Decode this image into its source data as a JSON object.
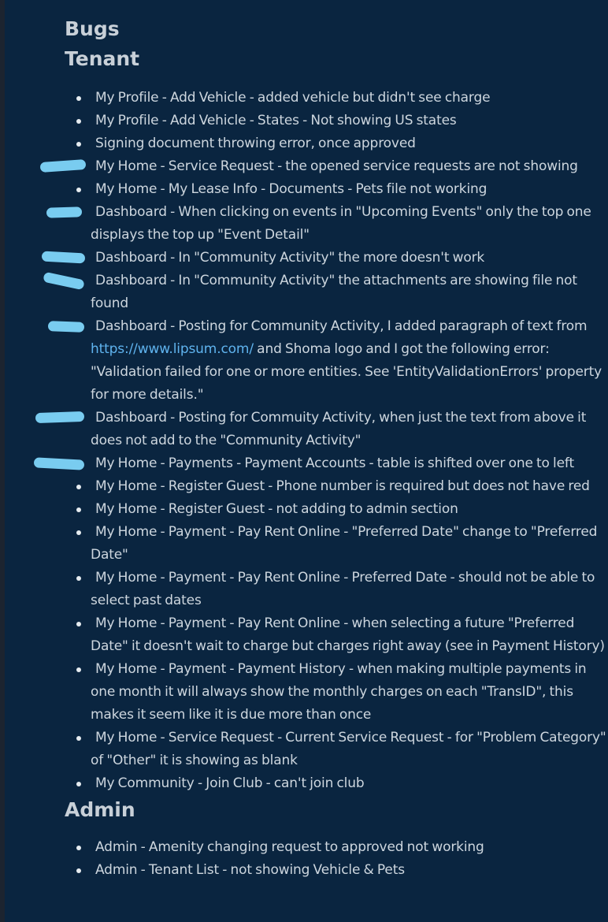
{
  "title": "Bugs",
  "tenant": {
    "heading": "Tenant",
    "items": [
      {
        "text": "My Profile - Add Vehicle - added vehicle but didn't see charge"
      },
      {
        "text": "My Profile - Add Vehicle - States - Not showing US states"
      },
      {
        "text": "Signing document throwing error, once approved"
      },
      {
        "text": "My Home - Service Request - the opened service requests are not showing"
      },
      {
        "text": "My Home - My Lease Info - Documents - Pets file not working"
      },
      {
        "text": "Dashboard - When clicking on events in \"Upcoming Events\" only the top one displays the top up \"Event Detail\""
      },
      {
        "text": "Dashboard - In \"Community Activity\" the more doesn't work"
      },
      {
        "text": "Dashboard - In \"Community Activity\" the attachments are showing file not found"
      },
      {
        "text_before": "Dashboard - Posting for Community Activity, I added paragraph of text from ",
        "link": "https://www.lipsum.com/",
        "text_after": " and Shoma logo and I got the following error: \"Validation failed for one or more entities. See 'EntityValidationErrors' property for more details.\""
      },
      {
        "text": "Dashboard - Posting for Commuity Activity, when just the text from above it does not add to the \"Community Activity\""
      },
      {
        "text": "My Home - Payments - Payment Accounts - table is shifted over one to left"
      },
      {
        "text": "My Home - Register Guest - Phone number is required but does not have red"
      },
      {
        "text": "My Home - Register Guest - not adding to admin section"
      },
      {
        "text": "My Home - Payment - Pay Rent Online - \"Preferred Date\" change to \"Preferred Date\""
      },
      {
        "text": "My Home - Payment - Pay Rent Online - Preferred Date - should not be able to select past dates"
      },
      {
        "text": "My Home - Payment - Pay Rent Online - when selecting a future \"Preferred Date\" it doesn't wait to charge but charges right away (see in Payment History)"
      },
      {
        "text": "My Home - Payment - Payment History - when making multiple payments in one month it will always show the monthly charges on each \"TransID\", this makes it seem like it is due more than once"
      },
      {
        "text": "My Home - Service Request - Current Service Request - for \"Problem Category\" of \"Other\" it is showing as blank"
      },
      {
        "text": "My Community - Join Club - can't join club"
      }
    ]
  },
  "admin": {
    "heading": "Admin",
    "items": [
      {
        "text": "Admin - Amenity changing request to approved not working"
      },
      {
        "text": "Admin - Tenant List - not showing Vehicle & Pets"
      }
    ]
  },
  "colors": {
    "background": "#0a2540",
    "text": "#cdd6de",
    "heading": "#c8d0d8",
    "link": "#5fb3ee",
    "highlight_marker": "#79ccf0"
  }
}
